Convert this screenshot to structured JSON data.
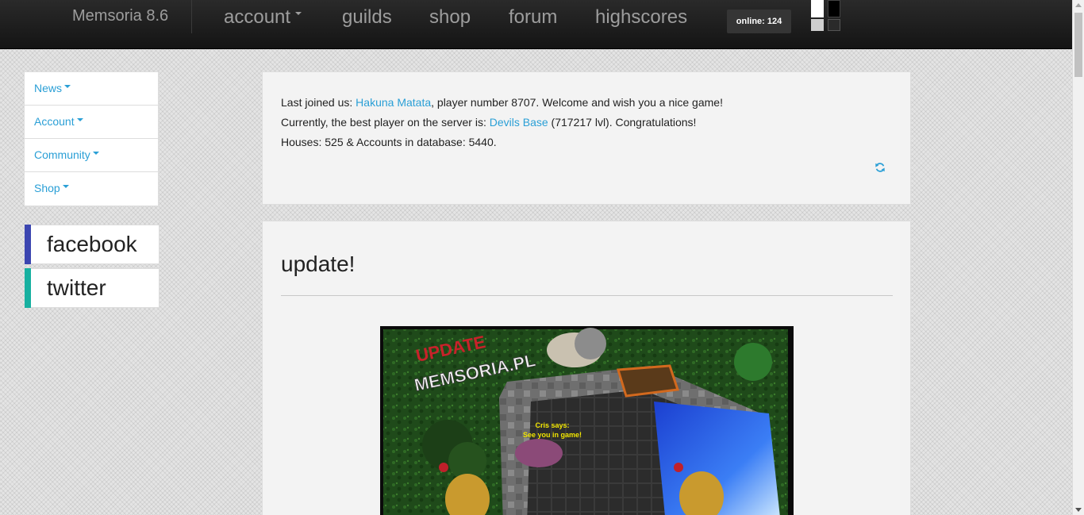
{
  "navbar": {
    "brand": "Memsoria 8.6",
    "links": [
      {
        "label": "account",
        "dropdown": true
      },
      {
        "label": "guilds"
      },
      {
        "label": "shop"
      },
      {
        "label": "forum"
      },
      {
        "label": "highscores"
      }
    ],
    "online_badge": "online: 124"
  },
  "sidebar": {
    "menu": [
      {
        "label": "News"
      },
      {
        "label": "Account"
      },
      {
        "label": "Community"
      },
      {
        "label": "Shop"
      }
    ],
    "social": [
      {
        "label": "facebook",
        "color": "#3b45b0"
      },
      {
        "label": "twitter",
        "color": "#17b0a0"
      }
    ]
  },
  "info": {
    "line1_prefix": "Last joined us: ",
    "last_player": "Hakuna Matata",
    "line1_suffix": ", player number 8707. Welcome and wish you a nice game!",
    "line2_prefix": "Currently, the best player on the server is: ",
    "best_player": "Devils Base",
    "line2_suffix": " (717217 lvl). Congratulations!",
    "line3": "Houses: 525 & Accounts in database: 5440."
  },
  "news": {
    "title": "update!",
    "image": {
      "overlay_update": "UPDATE",
      "overlay_site": "MEMSORIA.PL",
      "speech_name": "Cris says:",
      "speech_text": "See you in game!"
    }
  },
  "colors": {
    "link": "#2a9fd6",
    "navbar_bg": "#1c1c1c",
    "nav_text": "#9d9d9d"
  },
  "icons": {
    "refresh": "refresh-icon",
    "caret": "caret-down-icon"
  }
}
